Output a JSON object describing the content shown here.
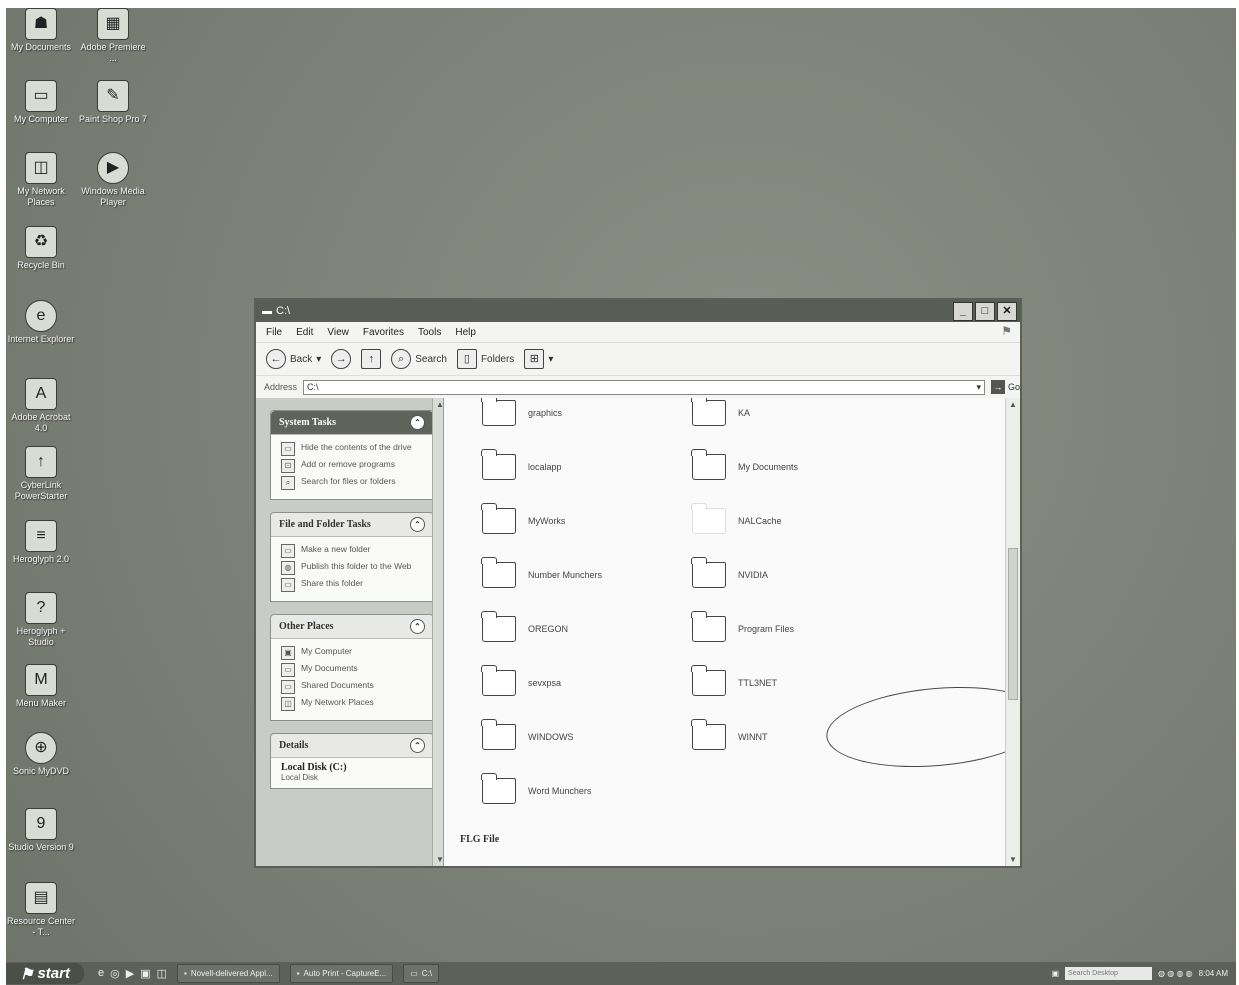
{
  "desktop_icons": [
    {
      "label": "My Documents",
      "icon": "documents-icon",
      "glyph": "☗"
    },
    {
      "label": "Adobe Premiere ...",
      "icon": "premiere-icon",
      "glyph": "▦"
    },
    {
      "label": "My Computer",
      "icon": "computer-icon",
      "glyph": "▭"
    },
    {
      "label": "Paint Shop Pro 7",
      "icon": "paintshop-icon",
      "glyph": "✎"
    },
    {
      "label": "My Network Places",
      "icon": "network-icon",
      "glyph": "◫"
    },
    {
      "label": "Windows Media Player",
      "icon": "mediaplayer-icon",
      "glyph": "▶"
    },
    {
      "label": "Recycle Bin",
      "icon": "recycle-bin-icon",
      "glyph": "♻"
    },
    {
      "label": "Internet Explorer",
      "icon": "ie-icon",
      "glyph": "e"
    },
    {
      "label": "Adobe Acrobat 4.0",
      "icon": "acrobat-icon",
      "glyph": "A"
    },
    {
      "label": "CyberLink PowerStarter",
      "icon": "cyberlink-icon",
      "glyph": "↑"
    },
    {
      "label": "Heroglyph 2.0",
      "icon": "heroglyph-icon",
      "glyph": "≡"
    },
    {
      "label": "Heroglyph + Studio",
      "icon": "heroglyph-studio-icon",
      "glyph": "?"
    },
    {
      "label": "Menu Maker",
      "icon": "menumaker-icon",
      "glyph": "M"
    },
    {
      "label": "Sonic MyDVD",
      "icon": "mydvd-icon",
      "glyph": "⊕"
    },
    {
      "label": "Studio Version 9",
      "icon": "studio-icon",
      "glyph": "9"
    },
    {
      "label": "Resource Center - T...",
      "icon": "resource-center-icon",
      "glyph": "▤"
    }
  ],
  "window": {
    "title": "C:\\",
    "menu": [
      "File",
      "Edit",
      "View",
      "Favorites",
      "Tools",
      "Help"
    ],
    "toolbar": {
      "back": "Back",
      "search": "Search",
      "folders": "Folders"
    },
    "address_label": "Address",
    "address_value": "C:\\",
    "go_label": "Go"
  },
  "system_tasks": {
    "title": "System Tasks",
    "items": [
      "Hide the contents of the drive",
      "Add or remove programs",
      "Search for files or folders"
    ]
  },
  "file_folder_tasks": {
    "title": "File and Folder Tasks",
    "items": [
      "Make a new folder",
      "Publish this folder to the Web",
      "Share this folder"
    ]
  },
  "other_places": {
    "title": "Other Places",
    "items": [
      "My Computer",
      "My Documents",
      "Shared Documents",
      "My Network Places"
    ]
  },
  "details": {
    "title": "Details",
    "name": "Local Disk (C:)",
    "type": "Local Disk"
  },
  "folders_left": [
    "graphics",
    "localapp",
    "MyWorks",
    "Number Munchers",
    "OREGON",
    "sevxpsa",
    "WINDOWS",
    "Word Munchers"
  ],
  "folders_right": [
    "KA",
    "My Documents",
    "NALCache",
    "NVIDIA",
    "Program Files",
    "TTL3NET",
    "WINNT"
  ],
  "group_header": "FLG File",
  "taskbar": {
    "start": "start",
    "tasks": [
      "Novell-delivered Appl...",
      "Auto Print - CaptureE...",
      "C:\\"
    ],
    "search_placeholder": "Search Desktop",
    "clock": "8:04 AM"
  }
}
